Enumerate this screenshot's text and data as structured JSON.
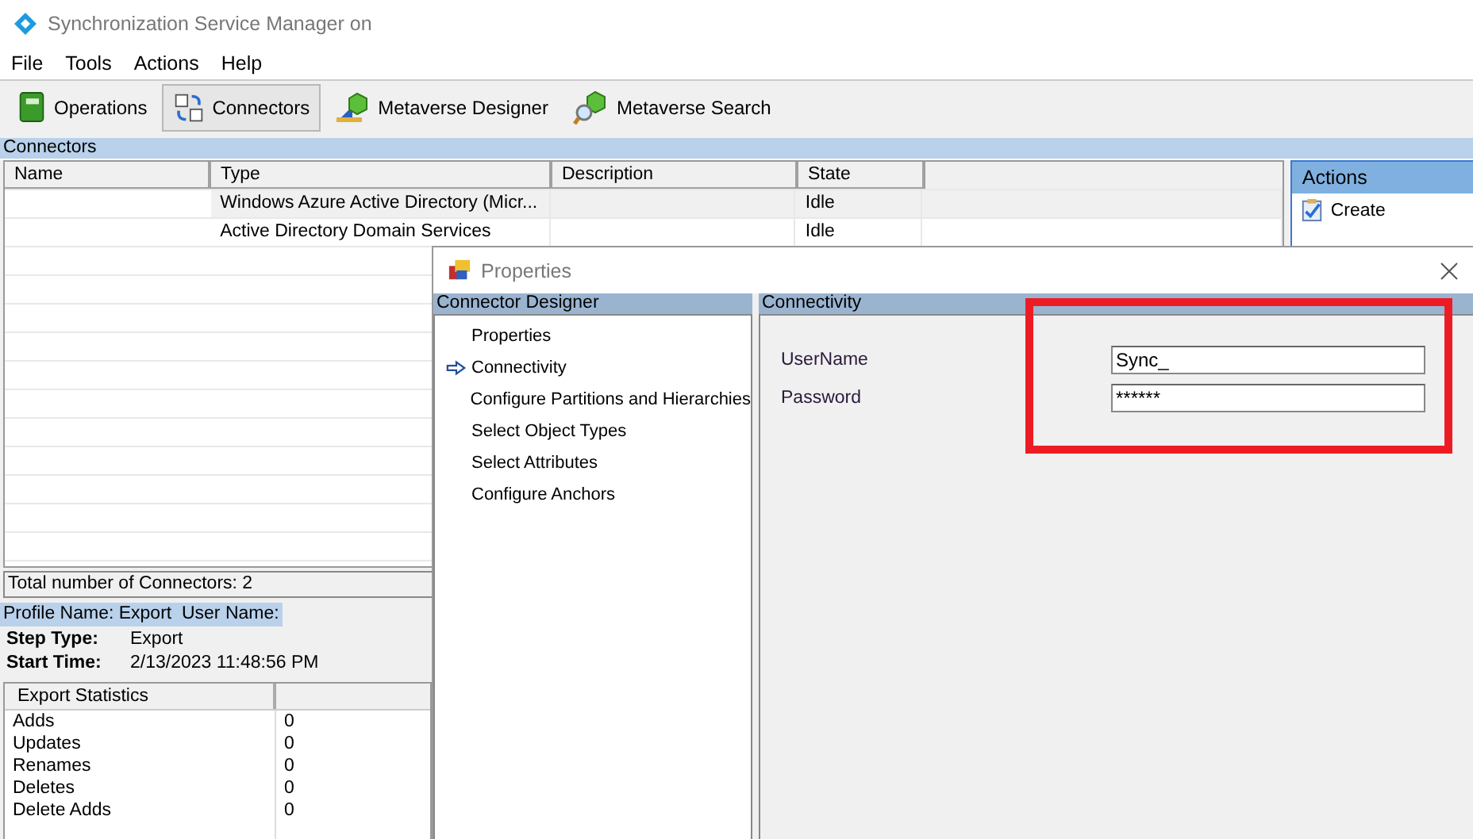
{
  "window": {
    "title": "Synchronization Service Manager on"
  },
  "menu": [
    "File",
    "Tools",
    "Actions",
    "Help"
  ],
  "toolbar": [
    {
      "label": "Operations",
      "kind": "book",
      "selected": false
    },
    {
      "label": "Connectors",
      "kind": "connectors",
      "selected": true
    },
    {
      "label": "Metaverse Designer",
      "kind": "designer",
      "selected": false
    },
    {
      "label": "Metaverse Search",
      "kind": "search",
      "selected": false
    }
  ],
  "connectors": {
    "header": "Connectors",
    "columns": [
      "Name",
      "Type",
      "Description",
      "State"
    ],
    "rows": [
      {
        "type": "Windows Azure Active Directory (Micr...",
        "state": "Idle",
        "selected": true
      },
      {
        "type": "Active Directory Domain Services",
        "state": "Idle",
        "selected": false
      }
    ],
    "total": "Total number of Connectors: 2"
  },
  "actions": {
    "header": "Actions",
    "items": [
      "Create"
    ]
  },
  "profile": {
    "header": "Profile Name: Export  User Name:",
    "step_type_label": "Step Type:",
    "step_type": "Export",
    "start_time_label": "Start Time:",
    "start_time": "2/13/2023 11:48:56 PM"
  },
  "export_statistics": {
    "header": "Export Statistics",
    "rows": [
      {
        "name": "Adds",
        "value": "0"
      },
      {
        "name": "Updates",
        "value": "0"
      },
      {
        "name": "Renames",
        "value": "0"
      },
      {
        "name": "Deletes",
        "value": "0"
      },
      {
        "name": "Delete Adds",
        "value": "0"
      }
    ]
  },
  "dialog": {
    "title": "Properties",
    "designer_header": "Connector Designer",
    "steps": [
      {
        "label": "Properties",
        "selected": false
      },
      {
        "label": "Connectivity",
        "selected": true
      },
      {
        "label": "Configure Partitions and Hierarchies",
        "selected": false
      },
      {
        "label": "Select Object Types",
        "selected": false
      },
      {
        "label": "Select Attributes",
        "selected": false
      },
      {
        "label": "Configure Anchors",
        "selected": false
      }
    ],
    "section_header": "Connectivity",
    "fields": [
      {
        "label": "UserName",
        "value": "Sync_"
      },
      {
        "label": "Password",
        "value": "******"
      }
    ]
  }
}
